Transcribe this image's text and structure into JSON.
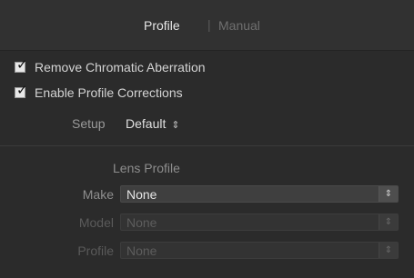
{
  "tabs": {
    "profile_label": "Profile",
    "separator": "|",
    "manual_label": "Manual",
    "active": "Profile"
  },
  "options": {
    "remove_ca": {
      "label": "Remove Chromatic Aberration",
      "checked": true
    },
    "enable_profile": {
      "label": "Enable Profile Corrections",
      "checked": true
    }
  },
  "setup": {
    "label": "Setup",
    "value": "Default",
    "arrows": "⇕"
  },
  "lens_profile": {
    "title": "Lens Profile",
    "make": {
      "label": "Make",
      "value": "None",
      "enabled": true
    },
    "model": {
      "label": "Model",
      "value": "None",
      "enabled": false
    },
    "profile": {
      "label": "Profile",
      "value": "None",
      "enabled": false
    },
    "select_arrows": "⇕"
  },
  "colors": {
    "background": "#2b2b2b",
    "header_background": "#313131",
    "active_text": "#e6e6e6",
    "disabled_text": "#5a5a5a"
  },
  "icons": {
    "checkbox": "check-icon",
    "select": "updown-arrows-icon"
  }
}
